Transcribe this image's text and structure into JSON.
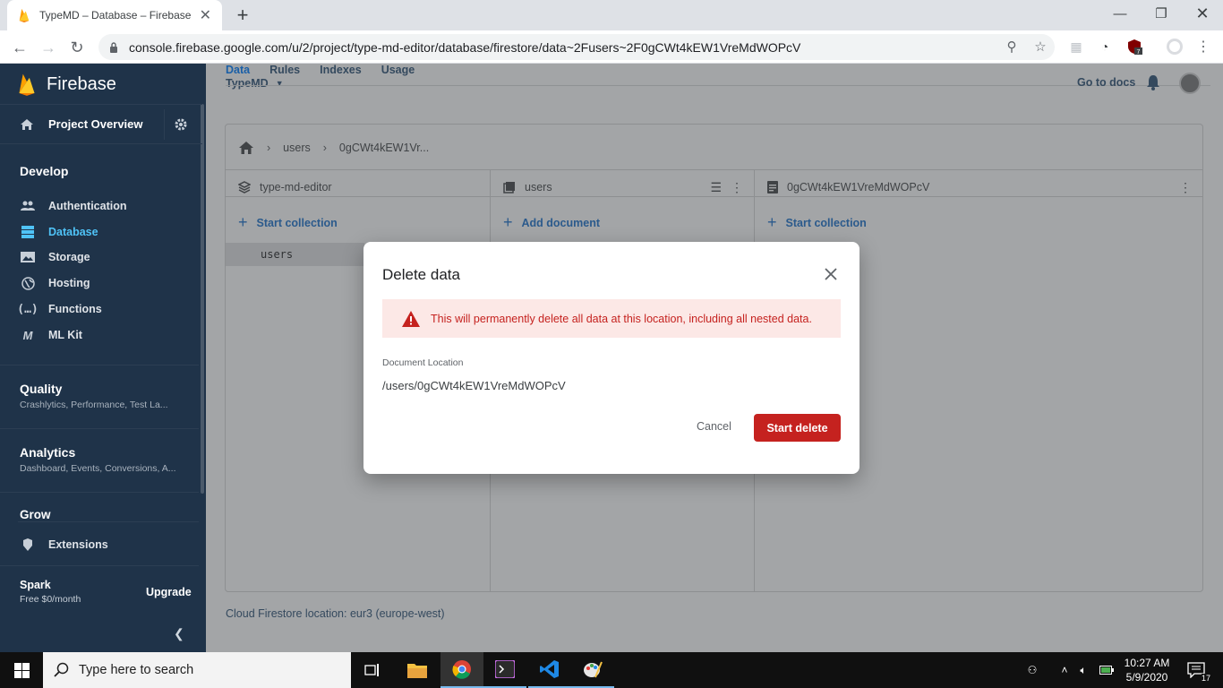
{
  "browser": {
    "tab_title": "TypeMD – Database – Firebase co",
    "url": "console.firebase.google.com/u/2/project/type-md-editor/database/firestore/data~2Fusers~2F0gCWt4kEW1VreMdWOPcV",
    "extension_badge": "7"
  },
  "sidebar": {
    "brand": "Firebase",
    "project_overview": "Project Overview",
    "develop_heading": "Develop",
    "develop_items": [
      "Authentication",
      "Database",
      "Storage",
      "Hosting",
      "Functions",
      "ML Kit"
    ],
    "quality_heading": "Quality",
    "quality_sub": "Crashlytics, Performance, Test La...",
    "analytics_heading": "Analytics",
    "analytics_sub": "Dashboard, Events, Conversions, A...",
    "grow_heading": "Grow",
    "extensions": "Extensions",
    "plan_name": "Spark",
    "plan_price": "Free $0/month",
    "upgrade": "Upgrade"
  },
  "header": {
    "tabs": [
      "Data",
      "Rules",
      "Indexes",
      "Usage"
    ],
    "project_name": "TypeMD",
    "go_to_docs": "Go to docs"
  },
  "firestore": {
    "breadcrumb": [
      "users",
      "0gCWt4kEW1Vr..."
    ],
    "col1_title": "type-md-editor",
    "col1_action": "Start collection",
    "col1_row": "users",
    "col2_title": "users",
    "col2_action": "Add document",
    "col3_title": "0gCWt4kEW1VreMdWOPcV",
    "col3_action": "Start collection",
    "location": "Cloud Firestore location: eur3 (europe-west)"
  },
  "dialog": {
    "title": "Delete data",
    "warning": "This will permanently delete all data at this location, including all nested data.",
    "doc_label": "Document Location",
    "doc_value": "/users/0gCWt4kEW1VreMdWOPcV",
    "cancel": "Cancel",
    "confirm": "Start delete"
  },
  "taskbar": {
    "search_placeholder": "Type here to search",
    "time": "10:27 AM",
    "date": "5/9/2020",
    "notifications": "17"
  }
}
